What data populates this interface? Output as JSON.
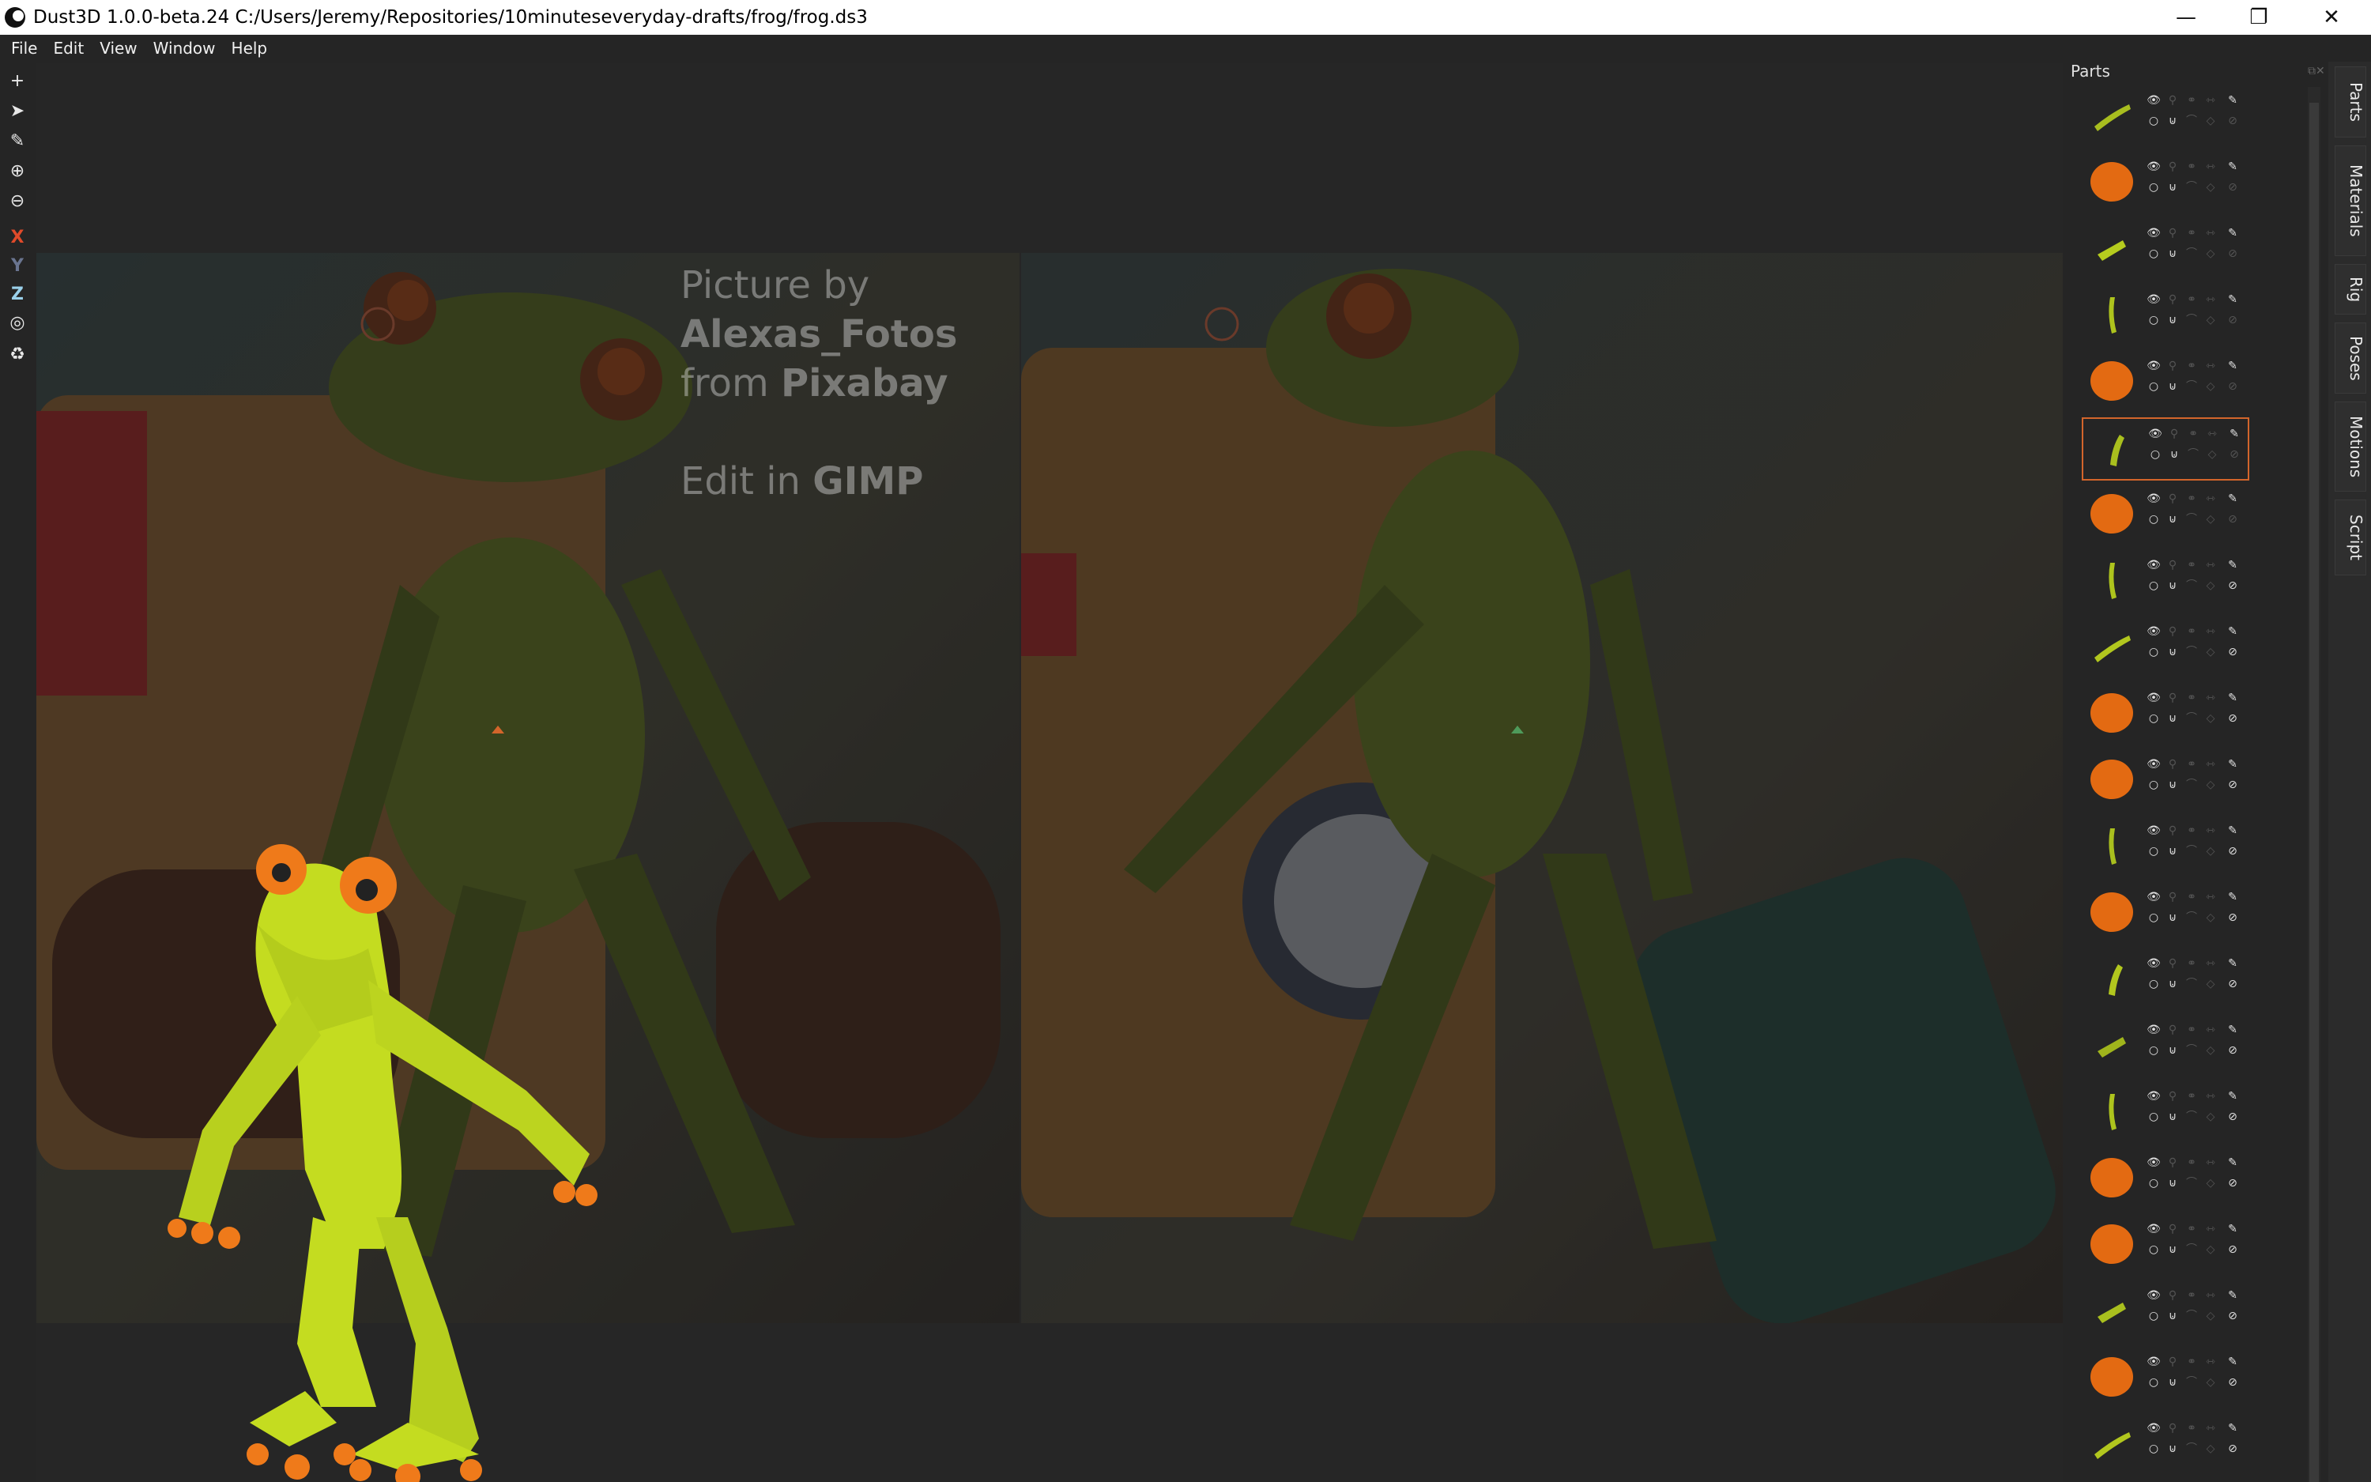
{
  "window": {
    "title": "Dust3D 1.0.0-beta.24 C:/Users/Jeremy/Repositories/10minuteseveryday-drafts/frog/frog.ds3",
    "minimize_glyph": "—",
    "restore_glyph": "❐",
    "close_glyph": "✕"
  },
  "menu": [
    "File",
    "Edit",
    "View",
    "Window",
    "Help"
  ],
  "toolbar": {
    "add": "+",
    "select": "➤",
    "paint": "✎",
    "zoom_in": "⊕",
    "zoom_out": "⊖",
    "x_axis": "X",
    "y_axis": "Y",
    "z_axis": "Z",
    "radius": "◎",
    "regenerate": "♻"
  },
  "overlay": {
    "line1_prefix": "Picture by ",
    "line1_bold": "Alexas_Fotos",
    "line2_prefix": "from ",
    "line2_bold": "Pixabay",
    "line3_prefix": "Edit in ",
    "line3_bold": "GIMP"
  },
  "parts_panel": {
    "title": "Parts",
    "parts": [
      {
        "shape": "limb",
        "color": "#a8bd1f"
      },
      {
        "shape": "ball",
        "color": "#e36a12"
      },
      {
        "shape": "limb",
        "color": "#b6cc1e"
      },
      {
        "shape": "limb",
        "color": "#aec41d"
      },
      {
        "shape": "ball",
        "color": "#e36a12"
      },
      {
        "shape": "limb",
        "color": "#a9bf1e",
        "selected": true
      },
      {
        "shape": "ball",
        "color": "#e36a12"
      },
      {
        "shape": "limb",
        "color": "#aec41d"
      },
      {
        "shape": "limb",
        "color": "#b2c71e"
      },
      {
        "shape": "ball",
        "color": "#e36a12"
      },
      {
        "shape": "ball",
        "color": "#e36a12"
      },
      {
        "shape": "limb",
        "color": "#a9bf1e"
      },
      {
        "shape": "ball",
        "color": "#e36a12"
      },
      {
        "shape": "limb",
        "color": "#b2c71e"
      },
      {
        "shape": "limb",
        "color": "#a0b51c"
      },
      {
        "shape": "limb",
        "color": "#aec41d"
      },
      {
        "shape": "ball",
        "color": "#e36a12"
      },
      {
        "shape": "ball",
        "color": "#e36a12"
      },
      {
        "shape": "limb",
        "color": "#a9bf1e"
      },
      {
        "shape": "ball",
        "color": "#e36a12"
      },
      {
        "shape": "limb",
        "color": "#b2c71e"
      }
    ]
  },
  "side_tabs": [
    "Parts",
    "Materials",
    "Rig",
    "Poses",
    "Motions",
    "Script"
  ],
  "colors": {
    "accent": "#d3652b",
    "frog_body": "#c4dc20",
    "frog_toe": "#ef7a1a",
    "background": "#252525"
  }
}
